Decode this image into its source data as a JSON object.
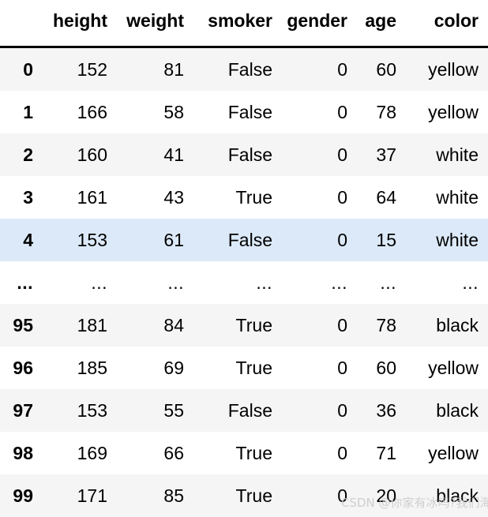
{
  "table": {
    "index_header": "",
    "columns": [
      "height",
      "weight",
      "smoker",
      "gender",
      "age",
      "color"
    ],
    "rows": [
      {
        "index": "0",
        "style": "stripe",
        "cells": [
          "152",
          "81",
          "False",
          "0",
          "60",
          "yellow"
        ]
      },
      {
        "index": "1",
        "style": "plain",
        "cells": [
          "166",
          "58",
          "False",
          "0",
          "78",
          "yellow"
        ]
      },
      {
        "index": "2",
        "style": "stripe",
        "cells": [
          "160",
          "41",
          "False",
          "0",
          "37",
          "white"
        ]
      },
      {
        "index": "3",
        "style": "plain",
        "cells": [
          "161",
          "43",
          "True",
          "0",
          "64",
          "white"
        ]
      },
      {
        "index": "4",
        "style": "highlight",
        "cells": [
          "153",
          "61",
          "False",
          "0",
          "15",
          "white"
        ]
      },
      {
        "index": "...",
        "style": "plain ellipsis",
        "cells": [
          "...",
          "...",
          "...",
          "...",
          "...",
          "..."
        ]
      },
      {
        "index": "95",
        "style": "stripe",
        "cells": [
          "181",
          "84",
          "True",
          "0",
          "78",
          "black"
        ]
      },
      {
        "index": "96",
        "style": "plain",
        "cells": [
          "185",
          "69",
          "True",
          "0",
          "60",
          "yellow"
        ]
      },
      {
        "index": "97",
        "style": "stripe",
        "cells": [
          "153",
          "55",
          "False",
          "0",
          "36",
          "black"
        ]
      },
      {
        "index": "98",
        "style": "plain",
        "cells": [
          "169",
          "66",
          "True",
          "0",
          "71",
          "yellow"
        ]
      },
      {
        "index": "99",
        "style": "stripe",
        "cells": [
          "171",
          "85",
          "True",
          "0",
          "20",
          "black"
        ]
      }
    ]
  },
  "watermark": {
    "text": "CSDN @你家有冰吗?我们海"
  },
  "colors": {
    "stripe": "#f5f5f5",
    "highlight": "#dce9f8",
    "text": "#000000",
    "header_rule": "#000000",
    "watermark": "#c9c9c9"
  }
}
